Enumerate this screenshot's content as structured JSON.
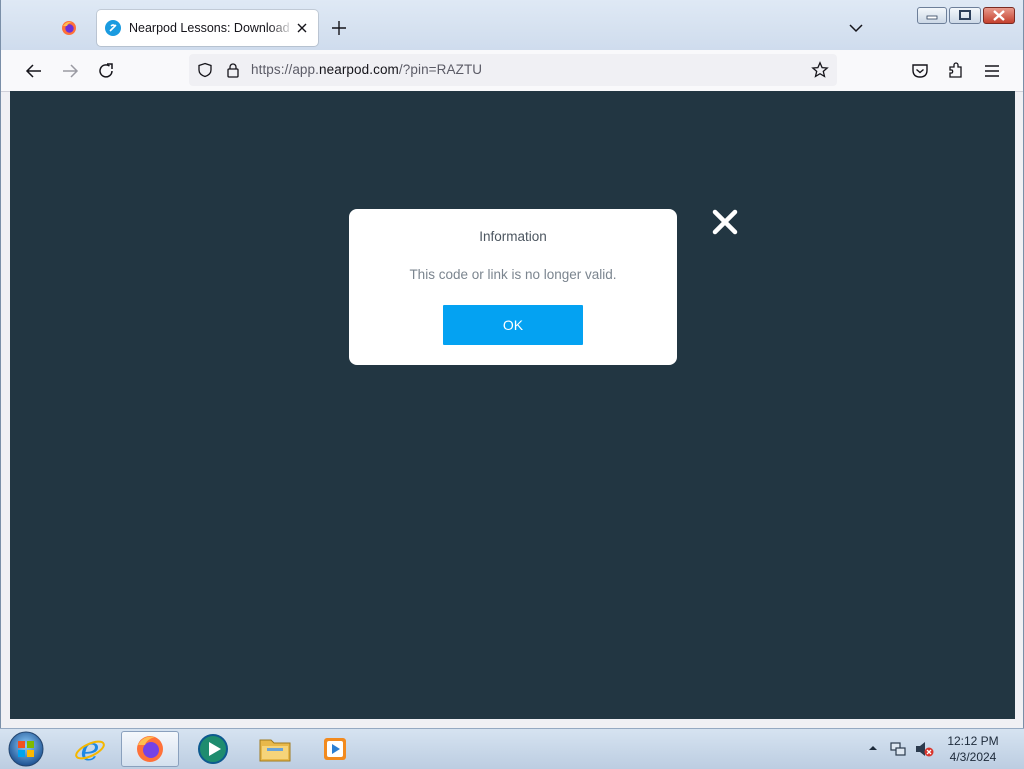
{
  "browser": {
    "tabs": [
      {
        "title": "Nearpod Lessons: Download ready",
        "favicon": "nearpod-icon",
        "active": true
      }
    ],
    "url": {
      "scheme": "https://app.",
      "host": "nearpod.com",
      "path": "/?pin=RAZTU"
    }
  },
  "dialog": {
    "title": "Information",
    "message": "This code or link is no longer valid.",
    "ok_label": "OK"
  },
  "colors": {
    "page_background": "#223642",
    "ok_button": "#04a2f2"
  },
  "taskbar": {
    "apps": [
      "internet-explorer-icon",
      "firefox-icon",
      "media-app-icon",
      "file-explorer-icon",
      "media-player-icon"
    ],
    "clock": {
      "time": "12:12 PM",
      "date": "4/3/2024"
    }
  }
}
